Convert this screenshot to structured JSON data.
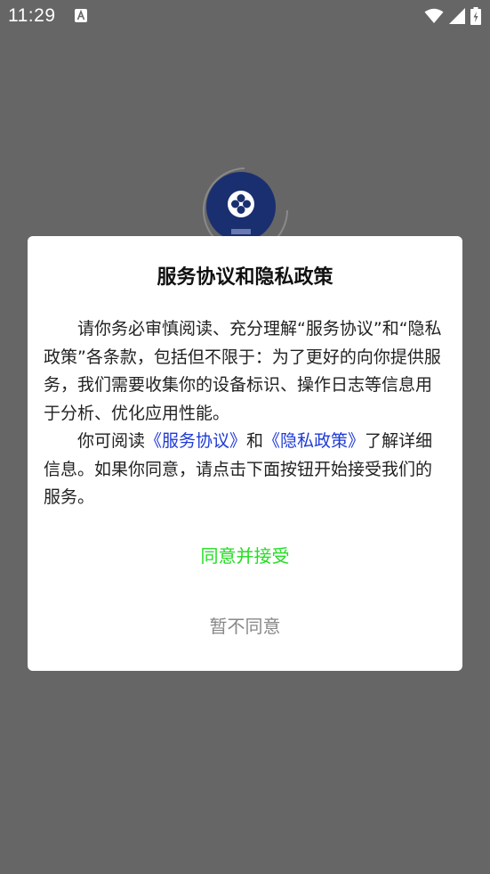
{
  "status_bar": {
    "time": "11:29"
  },
  "dialog": {
    "title": "服务协议和隐私政策",
    "paragraph1": "请你务必审慎阅读、充分理解“服务协议”和“隐私政策”各条款，包括但不限于：为了更好的向你提供服务，我们需要收集你的设备标识、操作日志等信息用于分析、优化应用性能。",
    "paragraph2_prefix": "你可阅读",
    "service_agreement_link": "《服务协议》",
    "paragraph2_and": "和",
    "privacy_policy_link": "《隐私政策》",
    "paragraph2_suffix": "了解详细信息。如果你同意，请点击下面按钮开始接受我们的服务。",
    "agree_label": "同意并接受",
    "disagree_label": "暂不同意"
  },
  "colors": {
    "overlay": "#666666",
    "agree": "#22dd22",
    "link": "#1e3ad6",
    "disagree": "#888888"
  },
  "icons": {
    "status_left": "a-notification-icon",
    "wifi": "wifi-icon",
    "signal": "signal-icon",
    "battery": "battery-icon",
    "app_logo": "app-logo"
  }
}
